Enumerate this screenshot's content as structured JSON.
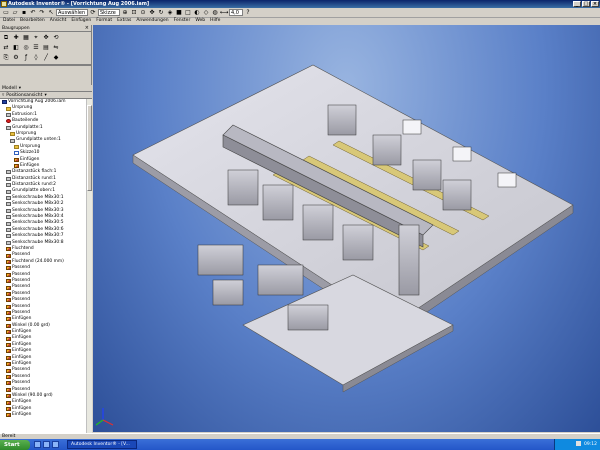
{
  "window": {
    "title": "Autodesk Inventor® - [Vorrichtung Aug 2006.iam]"
  },
  "toolbar": {
    "style_combo": "Auswählen",
    "color_combo": "Skizze",
    "zoom_combo": "4,0"
  },
  "menu": [
    "Datei",
    "Bearbeiten",
    "Ansicht",
    "Einfügen",
    "Format",
    "Extras",
    "Anwendungen",
    "Fenster",
    "Web",
    "Hilfe"
  ],
  "panel": {
    "title": "Baugruppen"
  },
  "browser": {
    "title": "Modell",
    "view_label": "Positionsansicht",
    "items": [
      {
        "label": "Vorrichtung Aug 2006.iam",
        "indent": 0,
        "icon": "assembly-icon"
      },
      {
        "label": "Ursprung",
        "indent": 1,
        "icon": "folder-icon"
      },
      {
        "label": "Extrusion:1",
        "indent": 1,
        "icon": "part-icon"
      },
      {
        "label": "Bauteilende",
        "indent": 1,
        "icon": "end-of-part-icon"
      },
      {
        "label": "Grundplatte:1",
        "indent": 1,
        "icon": "part-icon"
      },
      {
        "label": "Ursprung",
        "indent": 2,
        "icon": "folder-icon"
      },
      {
        "label": "Grundplatte unten:1",
        "indent": 2,
        "icon": "part-icon"
      },
      {
        "label": "Ursprung",
        "indent": 3,
        "icon": "folder-icon"
      },
      {
        "label": "Skizze10",
        "indent": 3,
        "icon": "sketch-icon"
      },
      {
        "label": "Einfügen",
        "indent": 3,
        "icon": "constraint-icon"
      },
      {
        "label": "Einfügen",
        "indent": 3,
        "icon": "constraint-icon"
      },
      {
        "label": "Distanzstück flach:1",
        "indent": 1,
        "icon": "part-icon"
      },
      {
        "label": "Distanzstück rund:1",
        "indent": 1,
        "icon": "part-icon"
      },
      {
        "label": "Distanzstück rund:2",
        "indent": 1,
        "icon": "part-icon"
      },
      {
        "label": "Grundplatte oben:1",
        "indent": 1,
        "icon": "part-icon"
      },
      {
        "label": "Senkschraube M8x30:1",
        "indent": 1,
        "icon": "part-icon"
      },
      {
        "label": "Senkschraube M8x30:2",
        "indent": 1,
        "icon": "part-icon"
      },
      {
        "label": "Senkschraube M8x30:3",
        "indent": 1,
        "icon": "part-icon"
      },
      {
        "label": "Senkschraube M8x30:4",
        "indent": 1,
        "icon": "part-icon"
      },
      {
        "label": "Senkschraube M8x30:5",
        "indent": 1,
        "icon": "part-icon"
      },
      {
        "label": "Senkschraube M8x30:6",
        "indent": 1,
        "icon": "part-icon"
      },
      {
        "label": "Senkschraube M8x30:7",
        "indent": 1,
        "icon": "part-icon"
      },
      {
        "label": "Senkschraube M8x30:8",
        "indent": 1,
        "icon": "part-icon"
      },
      {
        "label": "Fluchtend",
        "indent": 1,
        "icon": "constraint-icon"
      },
      {
        "label": "Passend",
        "indent": 1,
        "icon": "constraint-icon"
      },
      {
        "label": "Fluchtend (24.000 mm)",
        "indent": 1,
        "icon": "constraint-icon"
      },
      {
        "label": "Passend",
        "indent": 1,
        "icon": "constraint-icon"
      },
      {
        "label": "Passend",
        "indent": 1,
        "icon": "constraint-icon"
      },
      {
        "label": "Passend",
        "indent": 1,
        "icon": "constraint-icon"
      },
      {
        "label": "Passend",
        "indent": 1,
        "icon": "constraint-icon"
      },
      {
        "label": "Passend",
        "indent": 1,
        "icon": "constraint-icon"
      },
      {
        "label": "Passend",
        "indent": 1,
        "icon": "constraint-icon"
      },
      {
        "label": "Passend",
        "indent": 1,
        "icon": "constraint-icon"
      },
      {
        "label": "Passend",
        "indent": 1,
        "icon": "constraint-icon"
      },
      {
        "label": "Einfügen",
        "indent": 1,
        "icon": "constraint-icon"
      },
      {
        "label": "Winkel (0.00 grd)",
        "indent": 1,
        "icon": "constraint-icon"
      },
      {
        "label": "Einfügen",
        "indent": 1,
        "icon": "constraint-icon"
      },
      {
        "label": "Einfügen",
        "indent": 1,
        "icon": "constraint-icon"
      },
      {
        "label": "Einfügen",
        "indent": 1,
        "icon": "constraint-icon"
      },
      {
        "label": "Einfügen",
        "indent": 1,
        "icon": "constraint-icon"
      },
      {
        "label": "Einfügen",
        "indent": 1,
        "icon": "constraint-icon"
      },
      {
        "label": "Einfügen",
        "indent": 1,
        "icon": "constraint-icon"
      },
      {
        "label": "Passend",
        "indent": 1,
        "icon": "constraint-icon"
      },
      {
        "label": "Passend",
        "indent": 1,
        "icon": "constraint-icon"
      },
      {
        "label": "Passend",
        "indent": 1,
        "icon": "constraint-icon"
      },
      {
        "label": "Passend",
        "indent": 1,
        "icon": "constraint-icon"
      },
      {
        "label": "Winkel (90.00 grd)",
        "indent": 1,
        "icon": "constraint-icon"
      },
      {
        "label": "Einfügen",
        "indent": 1,
        "icon": "constraint-icon"
      },
      {
        "label": "Einfügen",
        "indent": 1,
        "icon": "constraint-icon"
      },
      {
        "label": "Einfügen",
        "indent": 1,
        "icon": "constraint-icon"
      }
    ]
  },
  "status": {
    "text": "Bereit"
  },
  "taskbar": {
    "start": "Start",
    "active_task": "Autodesk Inventor® - [V...",
    "clock": "09:12"
  },
  "colors": {
    "viewport_top": "#98b4e0",
    "viewport_bottom": "#2d4f98",
    "part_gray": "#c0c0c8",
    "rail_yellow": "#d8c878"
  }
}
